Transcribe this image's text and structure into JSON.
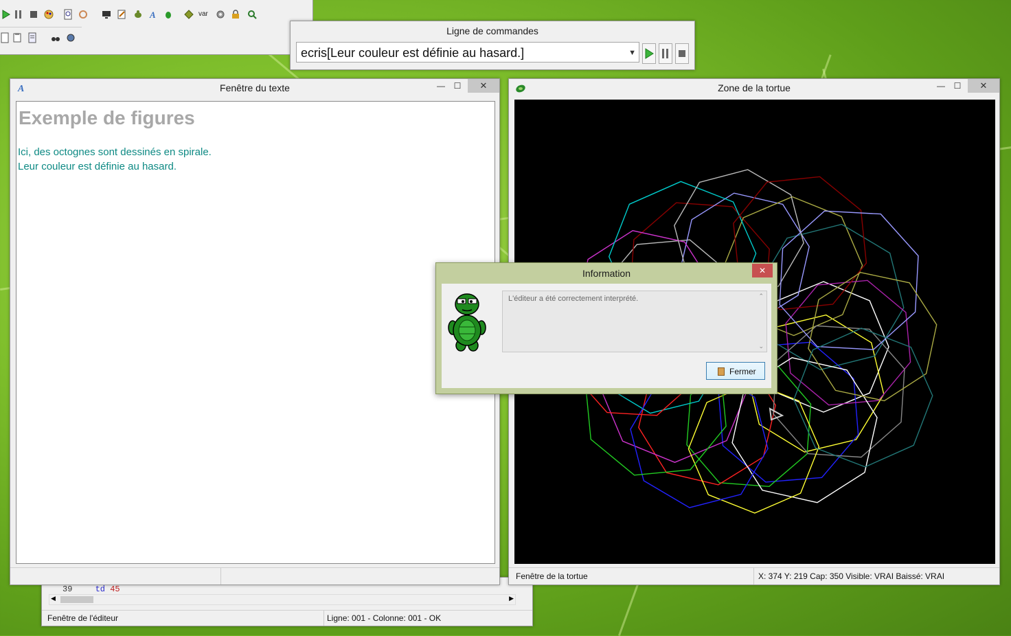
{
  "command_window": {
    "title": "Ligne de commandes",
    "input_value": "ecris[Leur couleur est définie au hasard.]"
  },
  "text_window": {
    "title": "Fenêtre du texte",
    "heading": "Exemple de figures",
    "lines": [
      "Ici, des octognes sont dessinés en spirale.",
      "Leur couleur est définie au hasard."
    ],
    "heading_color": "#a8a8a8",
    "body_color": "#0e8a84"
  },
  "turtle_window": {
    "title": "Zone de la tortue",
    "status_left": "Fenêtre de la tortue",
    "status_right": "X: 374 Y: 219 Cap: 350 Visible: VRAI Baissé: VRAI",
    "canvas_bg": "#000000"
  },
  "editor_window": {
    "status_left": "Fenêtre de l'éditeur",
    "status_right": "Ligne: 001 - Colonne: 001 - OK",
    "line_number": "39",
    "line_code_keyword": "td",
    "line_code_value": "45"
  },
  "dialog": {
    "title": "Information",
    "message": "L'éditeur a été correctement interprété.",
    "button_label": "Fermer",
    "frame_color": "#c3cf9f"
  },
  "toolbar": {
    "var_label": "var"
  },
  "window_controls": {
    "minimize": "—",
    "maximize": "☐",
    "close": "✕"
  }
}
